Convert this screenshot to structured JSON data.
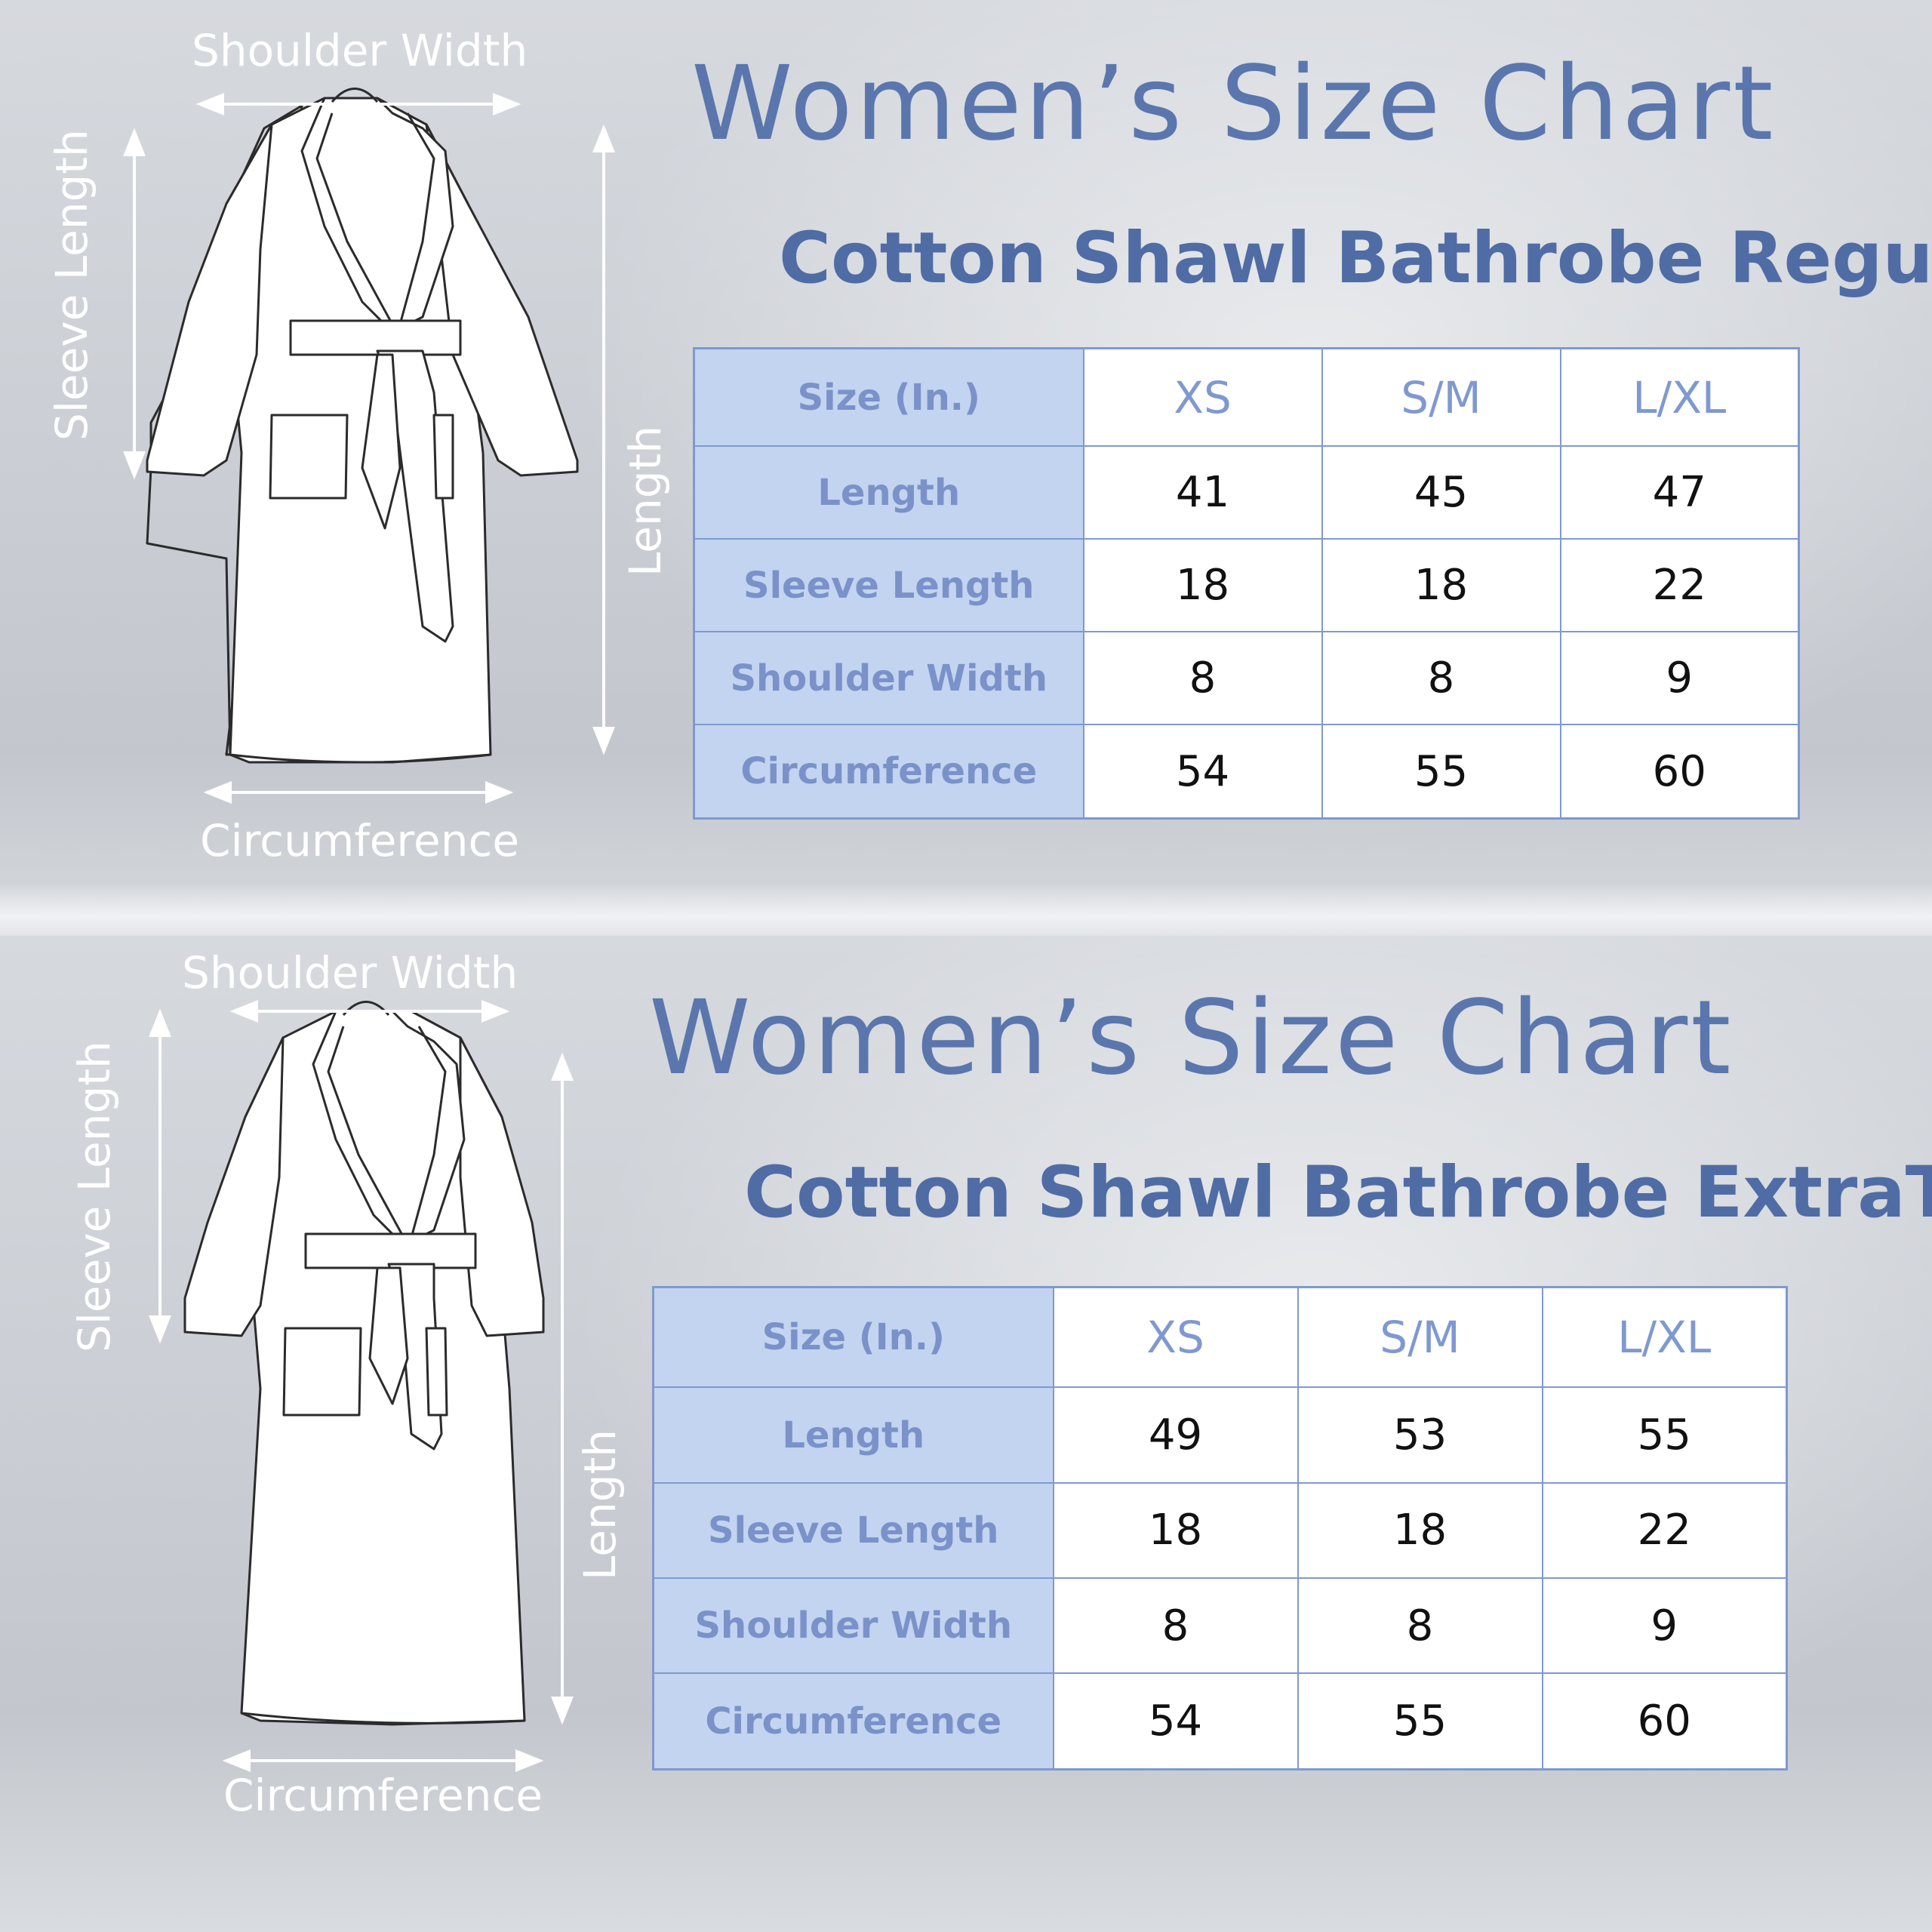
{
  "charts": [
    {
      "title": "Women’s Size Chart",
      "subtitle": "Cotton Shawl Bathrobe Regular",
      "diagram_labels": {
        "shoulder_width": "Shoulder Width",
        "sleeve_length": "Sleeve Length",
        "length": "Length",
        "circumference": "Circumference"
      },
      "table": {
        "corner": "Size (In.)",
        "columns": [
          "XS",
          "S/M",
          "L/XL"
        ],
        "rows": [
          {
            "label": "Length",
            "values": [
              "41",
              "45",
              "47"
            ]
          },
          {
            "label": "Sleeve Length",
            "values": [
              "18",
              "18",
              "22"
            ]
          },
          {
            "label": "Shoulder Width",
            "values": [
              "8",
              "8",
              "9"
            ]
          },
          {
            "label": "Circumference",
            "values": [
              "54",
              "55",
              "60"
            ]
          }
        ]
      }
    },
    {
      "title": "Women’s Size Chart",
      "subtitle": "Cotton Shawl Bathrobe ExtraTall",
      "diagram_labels": {
        "shoulder_width": "Shoulder Width",
        "sleeve_length": "Sleeve Length",
        "length": "Length",
        "circumference": "Circumference"
      },
      "table": {
        "corner": "Size (In.)",
        "columns": [
          "XS",
          "S/M",
          "L/XL"
        ],
        "rows": [
          {
            "label": "Length",
            "values": [
              "49",
              "53",
              "55"
            ]
          },
          {
            "label": "Sleeve Length",
            "values": [
              "18",
              "18",
              "22"
            ]
          },
          {
            "label": "Shoulder Width",
            "values": [
              "8",
              "8",
              "9"
            ]
          },
          {
            "label": "Circumference",
            "values": [
              "54",
              "55",
              "60"
            ]
          }
        ]
      }
    }
  ],
  "colors": {
    "title": "#5a76ad",
    "subtitle": "#506ca5",
    "table_border": "#7f99cf",
    "header_fill": "#c3d4f0",
    "header_text": "#7a92c9",
    "diagram_label": "#ffffff"
  },
  "icons": [
    "robe-regular-diagram-icon",
    "robe-extratall-diagram-icon"
  ]
}
